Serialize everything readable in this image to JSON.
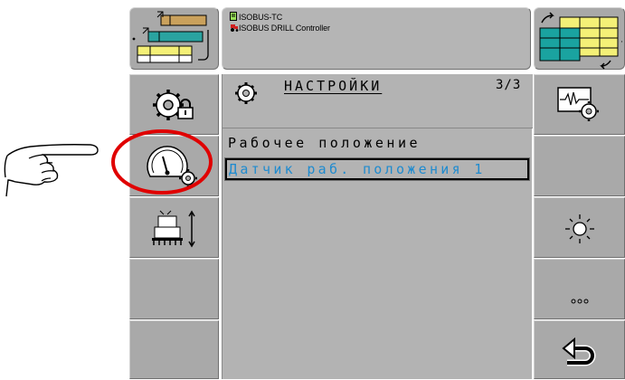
{
  "header": {
    "line1": "ISOBUS-TC",
    "line1_icon": "document-icon",
    "line2": "ISOBUS DRILL Controller",
    "line2_icon": "tractor-icon",
    "left_icon": "field-plan-icon",
    "right_icon": "switch-view-icon"
  },
  "left_softkeys": [
    {
      "name": "settings-lock-icon"
    },
    {
      "name": "gauge-settings-icon",
      "highlighted": true
    },
    {
      "name": "drill-height-icon"
    },
    {
      "name": "empty"
    },
    {
      "name": "empty"
    }
  ],
  "right_softkeys": [
    {
      "name": "diagnostics-icon"
    },
    {
      "name": "empty"
    },
    {
      "name": "brightness-icon"
    },
    {
      "name": "more-icon",
      "label": "..."
    },
    {
      "name": "back-icon"
    }
  ],
  "main": {
    "title": "НАСТРОЙКИ",
    "page_indicator": "3/3",
    "title_icon": "settings-gear-icon",
    "param_label": "Рабочее положение",
    "param_value": "Датчик раб. положения 1"
  },
  "colors": {
    "key_bg": "#a9a9a9",
    "panel_bg": "#b3b3b3",
    "value_text": "#1f8bcf",
    "highlight_circle": "#e00000"
  }
}
